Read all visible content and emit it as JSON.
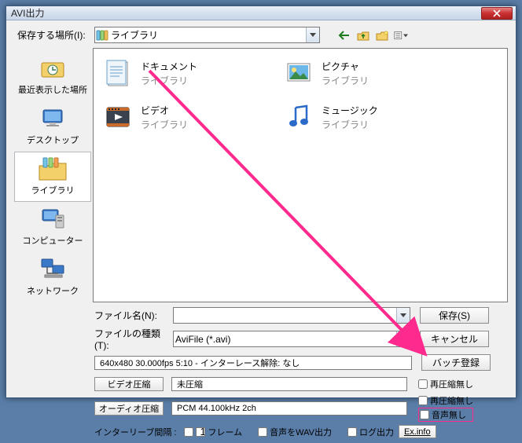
{
  "window": {
    "title": "AVI出力"
  },
  "location": {
    "label": "保存する場所(I):",
    "value": "ライブラリ"
  },
  "places": [
    {
      "name": "recent",
      "label": "最近表示した場所",
      "icon": "recent-places"
    },
    {
      "name": "desktop",
      "label": "デスクトップ",
      "icon": "desktop"
    },
    {
      "name": "libraries",
      "label": "ライブラリ",
      "icon": "libraries",
      "selected": true
    },
    {
      "name": "computer",
      "label": "コンピューター",
      "icon": "computer"
    },
    {
      "name": "network",
      "label": "ネットワーク",
      "icon": "network"
    }
  ],
  "libraries_sub": "ライブラリ",
  "libraries": [
    {
      "title": "ドキュメント",
      "icon": "documents"
    },
    {
      "title": "ピクチャ",
      "icon": "pictures"
    },
    {
      "title": "ビデオ",
      "icon": "videos"
    },
    {
      "title": "ミュージック",
      "icon": "music"
    }
  ],
  "filename": {
    "label": "ファイル名(N):",
    "value": ""
  },
  "filetype": {
    "label": "ファイルの種類(T):",
    "value": "AviFile (*.avi)"
  },
  "buttons": {
    "save": "保存(S)",
    "cancel": "キャンセル",
    "batch": "バッチ登録",
    "video_comp": "ビデオ圧縮",
    "audio_comp": "オーディオ圧縮",
    "exinfo": "Ex.info"
  },
  "info": "640x480  30.000fps  5:10  -  インターレース解除: なし",
  "video_codec": "未圧縮",
  "audio_codec": "PCM 44.100kHz 2ch",
  "checks": {
    "no_recompress_v": "再圧縮無し",
    "no_recompress_a": "再圧縮無し",
    "no_audio": "音声無し"
  },
  "interleave": {
    "label": "インターリーブ間隔 :",
    "value": "1",
    "unit": "フレーム",
    "wav_out": "音声をWAV出力",
    "log_out": "ログ出力"
  },
  "colors": {
    "arrow": "#ff2a8d"
  }
}
